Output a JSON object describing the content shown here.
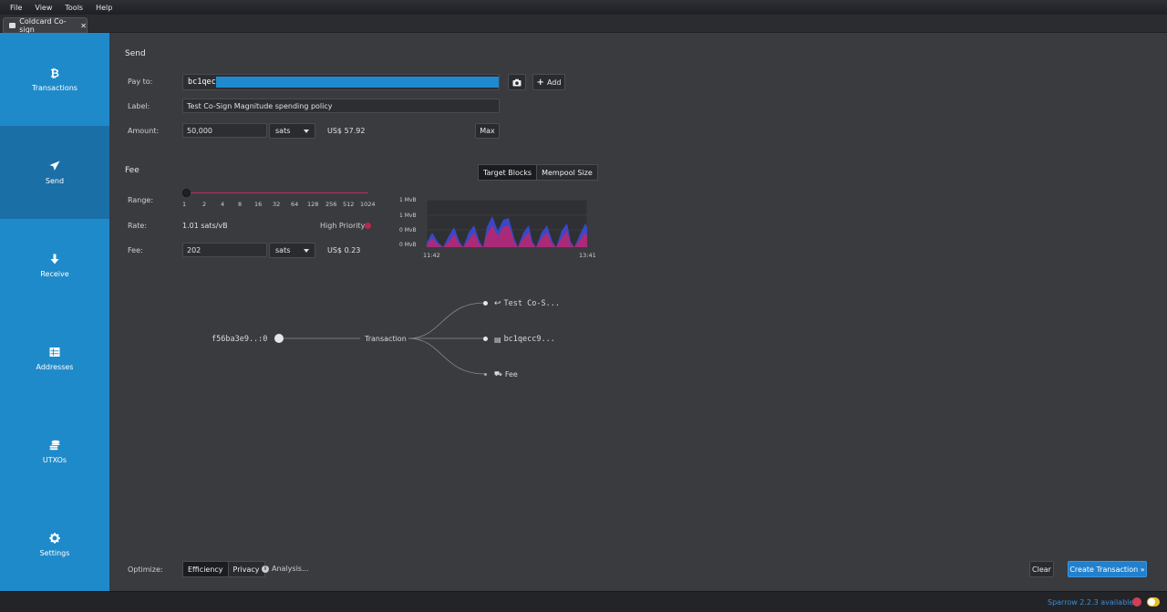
{
  "menu": [
    "File",
    "View",
    "Tools",
    "Help"
  ],
  "tab": {
    "label": "Coldcard Co-sign",
    "close": "✕"
  },
  "sidebar": [
    {
      "id": "transactions",
      "label": "Transactions",
      "icon": "bitcoin-icon"
    },
    {
      "id": "send",
      "label": "Send",
      "icon": "paper-plane-icon",
      "active": true
    },
    {
      "id": "receive",
      "label": "Receive",
      "icon": "arrow-down-icon"
    },
    {
      "id": "addresses",
      "label": "Addresses",
      "icon": "table-icon"
    },
    {
      "id": "utxos",
      "label": "UTXOs",
      "icon": "coins-icon"
    },
    {
      "id": "settings",
      "label": "Settings",
      "icon": "gear-icon"
    }
  ],
  "send": {
    "title": "Send",
    "pay_to_label": "Pay to:",
    "pay_to_value": "bc1qec",
    "camera_icon": "camera-icon",
    "add_label": "Add",
    "label_label": "Label:",
    "label_value": "Test Co-Sign Magnitude spending policy",
    "amount_label": "Amount:",
    "amount_value": "50,000",
    "amount_unit": "sats",
    "amount_fiat": "US$ 57.92",
    "max_label": "Max"
  },
  "fee": {
    "title": "Fee",
    "toggle": [
      "Target Blocks",
      "Mempool Size"
    ],
    "toggle_active": "Mempool Size",
    "range_label": "Range:",
    "range_ticks": [
      "1",
      "2",
      "4",
      "8",
      "16",
      "32",
      "64",
      "128",
      "256",
      "512",
      "1024"
    ],
    "range_position": 0,
    "rate_label": "Rate:",
    "rate_value": "1.01 sats/vB",
    "priority_label": "High Priority",
    "fee_label": "Fee:",
    "fee_value": "202",
    "fee_unit": "sats",
    "fee_fiat": "US$ 0.23"
  },
  "chart_data": {
    "type": "area",
    "y_ticks": [
      "1 MvB",
      "1 MvB",
      "0 MvB",
      "0 MvB"
    ],
    "x_ticks": [
      "11:42",
      "13:41"
    ],
    "colors": {
      "primary": "#3c4bd6",
      "secondary": "#c0266a"
    }
  },
  "diagram": {
    "input": "f56ba3e9..:0",
    "center": "Transaction",
    "outputs": [
      {
        "label": "Test Co-S...",
        "icon": "reply-icon"
      },
      {
        "label": "bc1qecc9...",
        "icon": "wallet-icon"
      },
      {
        "label": "Fee",
        "icon": "fee-icon"
      }
    ]
  },
  "footer": {
    "optimize_label": "Optimize:",
    "optimize_options": [
      "Efficiency",
      "Privacy"
    ],
    "analysis_label": "Analysis...",
    "clear_label": "Clear",
    "create_label": "Create Transaction »"
  },
  "status": {
    "update_text": "Sparrow 2.2.3 available"
  },
  "colors": {
    "accent": "#1f8ac9",
    "sidebar_active": "#1a6fa6",
    "create_button": "#2181cf",
    "update_text": "#3a8ed6"
  }
}
